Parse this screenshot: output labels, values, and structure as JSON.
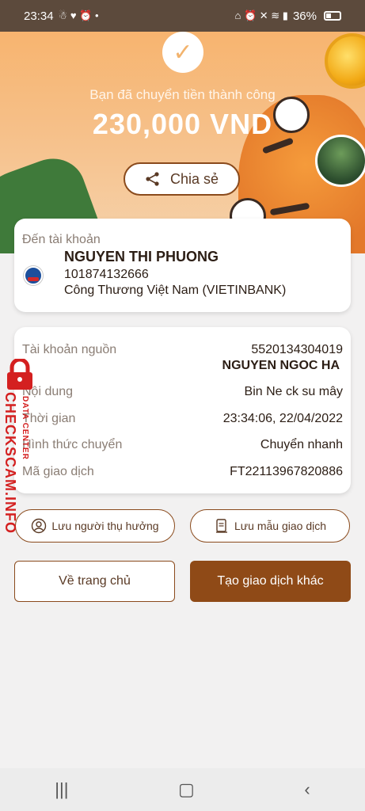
{
  "status_bar": {
    "time": "23:34",
    "battery": "36%"
  },
  "hero": {
    "success_text": "Bạn đã chuyển tiền thành công",
    "amount": "230,000 VND",
    "share_label": "Chia sẻ"
  },
  "recipient": {
    "label": "Đến tài khoản",
    "name": "NGUYEN THI PHUONG",
    "account_number": "101874132666",
    "bank_name": "Công Thương Việt Nam (VIETINBANK)"
  },
  "details": {
    "source_label": "Tài khoản nguồn",
    "source_account": "5520134304019",
    "source_name": "NGUYEN NGOC HA",
    "content_label": "Nội dung",
    "content_value": "Bin Ne ck su mây",
    "time_label": "Thời gian",
    "time_value": "23:34:06, 22/04/2022",
    "method_label": "Hình thức chuyển",
    "method_value": "Chuyển nhanh",
    "txn_label": "Mã giao dịch",
    "txn_value": "FT22113967820886"
  },
  "actions": {
    "save_payee": "Lưu người thụ hưởng",
    "save_template": "Lưu mẫu giao dịch",
    "home": "Về trang chủ",
    "new_transaction": "Tạo giao dịch khác"
  },
  "watermark": {
    "main": "CHECKSCAM.INFO",
    "sub": "DATA CENTER"
  },
  "colors": {
    "accent": "#8f4a17",
    "hero_top": "#f7b46f",
    "watermark": "#d42020"
  }
}
